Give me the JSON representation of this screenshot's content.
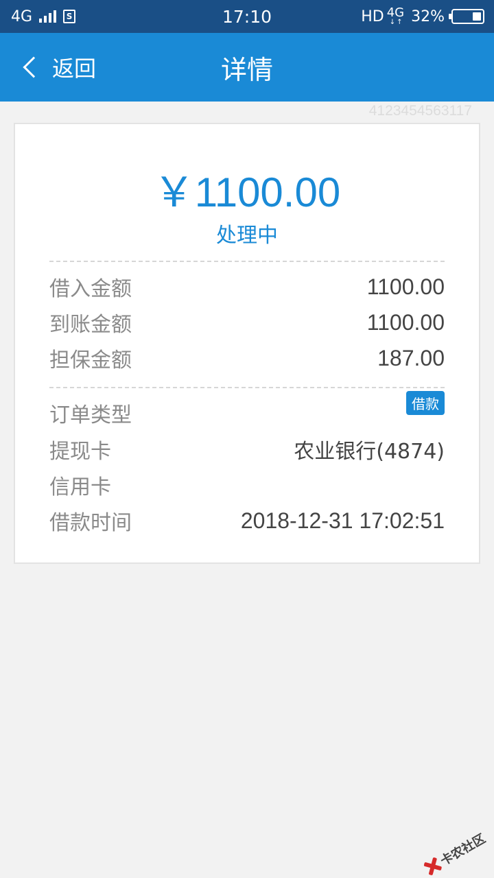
{
  "status_bar": {
    "network_left": "4G",
    "time": "17:10",
    "hd": "HD",
    "network_right": "4G",
    "battery": "32%"
  },
  "header": {
    "back_label": "返回",
    "title": "详情"
  },
  "watermark_id": "4123454563117",
  "detail": {
    "amount": "￥1100.00",
    "status": "处理中",
    "rows1": [
      {
        "label": "借入金额",
        "value": "1100.00"
      },
      {
        "label": "到账金额",
        "value": "1100.00"
      },
      {
        "label": "担保金额",
        "value": "187.00"
      }
    ],
    "order_type_label": "订单类型",
    "order_type_badge": "借款",
    "withdraw_card_label": "提现卡",
    "withdraw_card_value": "农业银行(4874)",
    "credit_card_label": "信用卡",
    "credit_card_value": "",
    "loan_time_label": "借款时间",
    "loan_time_value": "2018-12-31 17:02:51"
  },
  "logo_text": "卡农社区",
  "colors": {
    "status_bar": "#1a4f86",
    "header": "#1a8ad6",
    "accent": "#1a8ad6",
    "background": "#f2f2f2"
  }
}
